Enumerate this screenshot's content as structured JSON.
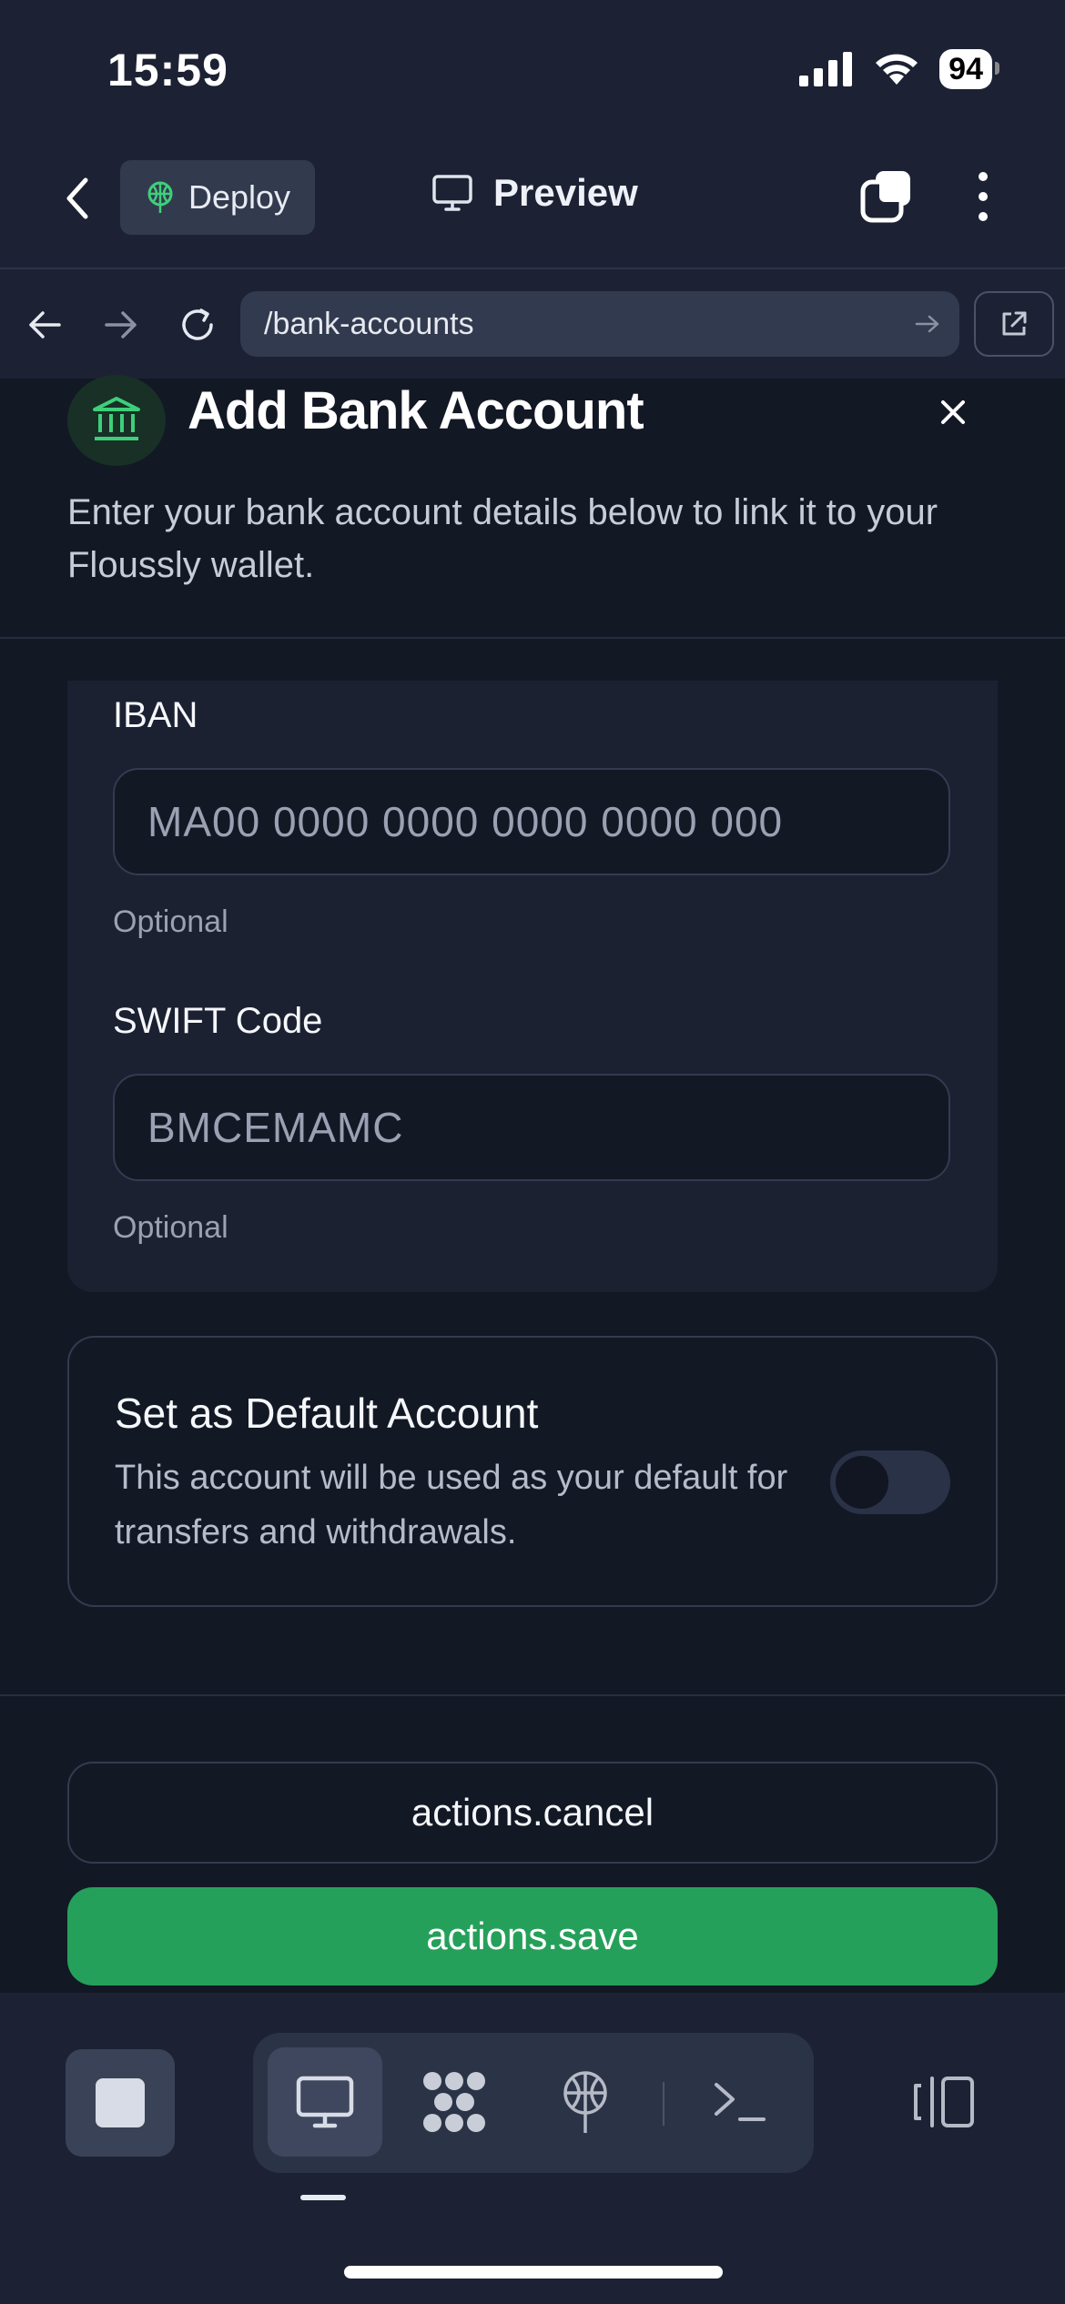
{
  "status_bar": {
    "time": "15:59",
    "battery": "94"
  },
  "header": {
    "deploy_label": "Deploy",
    "preview_label": "Preview"
  },
  "browser": {
    "url": "/bank-accounts"
  },
  "dialog": {
    "title": "Add Bank Account",
    "description": "Enter your bank account details below to link it to your Floussly wallet."
  },
  "form": {
    "iban": {
      "label": "IBAN",
      "placeholder": "MA00 0000 0000 0000 0000 000",
      "hint": "Optional"
    },
    "swift": {
      "label": "SWIFT Code",
      "placeholder": "BMCEMAMC",
      "hint": "Optional"
    }
  },
  "default_account": {
    "title": "Set as Default Account",
    "description": "This account will be used as your default for transfers and withdrawals.",
    "enabled": false
  },
  "actions": {
    "cancel": "actions.cancel",
    "save": "actions.save"
  },
  "colors": {
    "accent_green": "#25a05a",
    "background": "#1c2233",
    "content_bg": "#131825"
  }
}
